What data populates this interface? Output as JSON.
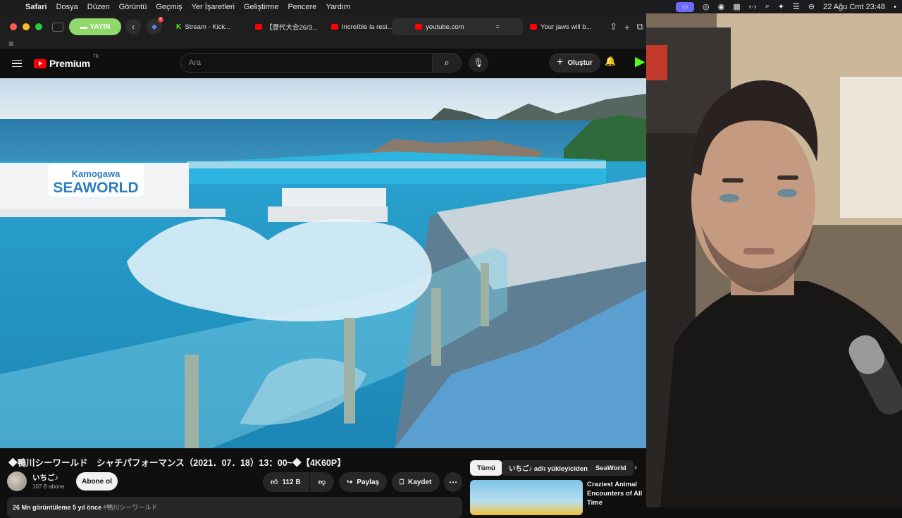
{
  "menubar": {
    "app": "Safari",
    "items": [
      "Dosya",
      "Düzen",
      "Görüntü",
      "Geçmiş",
      "Yer İşaretleri",
      "Geliştirme",
      "Pencere",
      "Yardım"
    ],
    "datetime": "22 Ağu Cmt  23:48"
  },
  "browser": {
    "profile_label": "YAYIN",
    "extension_badge": "6",
    "tabs": [
      {
        "label": "Stream - Kick...",
        "icon": "kick-icon"
      },
      {
        "label": "【歴代大会26/3...",
        "icon": "youtube-icon"
      },
      {
        "label": "Increíble la resi...",
        "icon": "youtube-icon"
      },
      {
        "label": "youtube.com",
        "icon": "youtube-icon",
        "active": true
      },
      {
        "label": "Your jaws will b...",
        "icon": "youtube-icon"
      }
    ]
  },
  "youtube": {
    "logo_text": "Premium",
    "region": "TR",
    "search_placeholder": "Ara",
    "create_label": "Oluştur",
    "video": {
      "sign_line1": "Kamogawa",
      "sign_line2": "SEAWORLD",
      "title": "◆鴨川シーワールド　シャチパフォーマンス（2021．07．18）13：00~◆【4K60P】",
      "channel": "いちご♪",
      "subscribers": "107 B abone",
      "subscribe_label": "Abone ol",
      "likes": "112 B",
      "share_label": "Paylaş",
      "save_label": "Kaydet",
      "views_line": "26 Mn görüntüleme  5 yıl önce",
      "views_tag": "  #鴨川シーワールド"
    },
    "chips": [
      "Tümü",
      "いちご♪ adlı yükleyiciden",
      "SeaWorld"
    ],
    "related": {
      "title": "Craziest Animal Encounters of All Time"
    }
  }
}
